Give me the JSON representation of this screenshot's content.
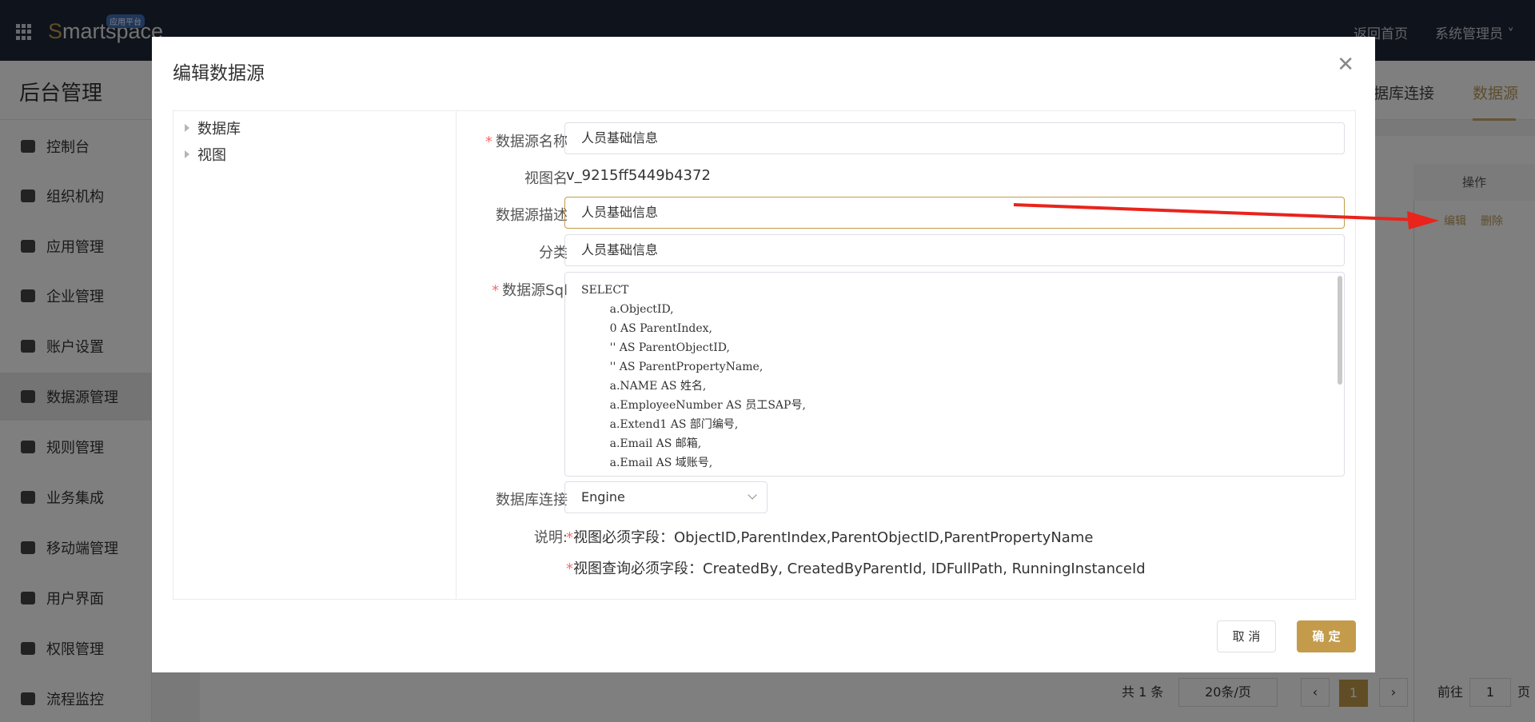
{
  "app": {
    "logo_rest": "martspace",
    "logo_s": "S",
    "badge": "应用平台",
    "home_link": "返回首页",
    "user_menu": "系统管理员"
  },
  "page": {
    "title": "后台管理",
    "tabs": [
      "据库连接",
      "数据源"
    ],
    "table_header_action": "操作",
    "row_actions": [
      "编辑",
      "删除"
    ],
    "pager": {
      "total": "共 1 条",
      "page_size": "20条/页",
      "current": "1",
      "goto_label": "前往",
      "goto_value": "1",
      "goto_suffix": "页"
    }
  },
  "sidebar": {
    "items": [
      {
        "label": "控制台",
        "icon": "dashboard-icon"
      },
      {
        "label": "组织机构",
        "icon": "users-icon"
      },
      {
        "label": "应用管理",
        "icon": "app-settings-icon"
      },
      {
        "label": "企业管理",
        "icon": "building-icon"
      },
      {
        "label": "账户设置",
        "icon": "user-settings-icon"
      },
      {
        "label": "数据源管理",
        "icon": "database-icon"
      },
      {
        "label": "规则管理",
        "icon": "rules-icon"
      },
      {
        "label": "业务集成",
        "icon": "integration-icon"
      },
      {
        "label": "移动端管理",
        "icon": "mobile-icon"
      },
      {
        "label": "用户界面",
        "icon": "layout-icon"
      },
      {
        "label": "权限管理",
        "icon": "permission-icon"
      },
      {
        "label": "流程监控",
        "icon": "monitor-icon"
      }
    ]
  },
  "modal": {
    "title": "编辑数据源",
    "tree": [
      "数据库",
      "视图"
    ],
    "fields": {
      "name_label": "数据源名称",
      "name_value": "人员基础信息",
      "view_label": "视图名",
      "view_value": "v_9215ff5449b4372",
      "desc_label": "数据源描述",
      "desc_value": "人员基础信息",
      "category_label": "分类",
      "category_value": "人员基础信息",
      "sql_label": "数据源Sql",
      "sql_value": "SELECT\n        a.ObjectID,\n        0 AS ParentIndex,\n        '' AS ParentObjectID,\n        '' AS ParentPropertyName,\n        a.NAME AS 姓名,\n        a.EmployeeNumber AS 员工SAP号,\n        a.Extend1 AS 部门编号,\n        a.Email AS 邮箱,\n        a.Email AS 域账号,",
      "db_label": "数据库连接",
      "db_value": "Engine",
      "note_label": "说明:",
      "note1": "视图必须字段：ObjectID,ParentIndex,ParentObjectID,ParentPropertyName",
      "note2": "视图查询必须字段：CreatedBy, CreatedByParentId, IDFullPath, RunningInstanceId"
    },
    "cancel": "取 消",
    "ok": "确 定"
  },
  "colors": {
    "accent": "#c39b4b",
    "topbar": "#1f2637",
    "annotation_arrow": "#e8241c"
  }
}
